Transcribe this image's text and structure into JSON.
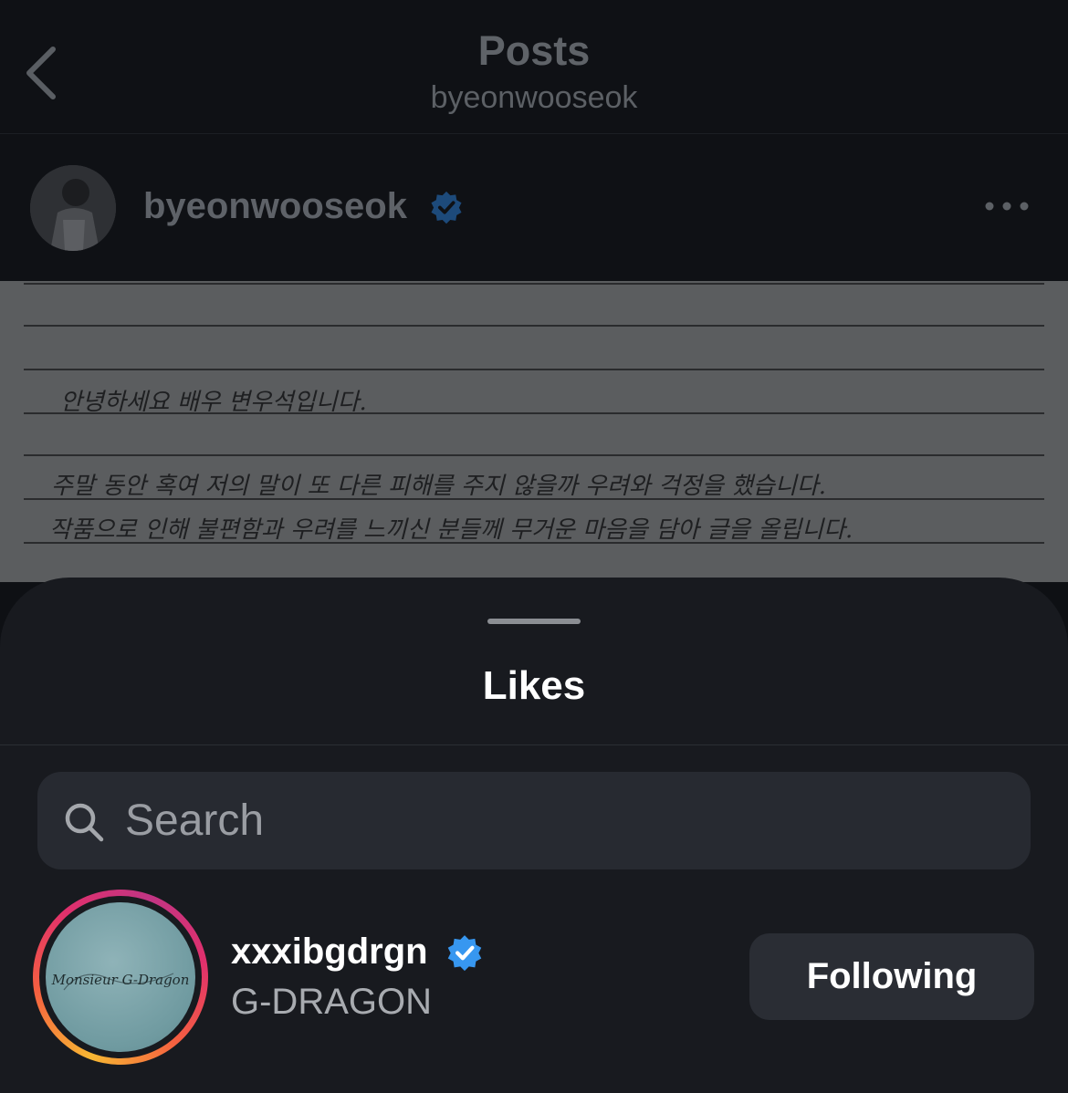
{
  "header": {
    "title": "Posts",
    "subtitle": "byeonwooseok"
  },
  "post": {
    "username": "byeonwooseok",
    "verified": true,
    "letter_lines": [
      "안녕하세요 배우 변우석입니다.",
      "주말 동안 혹여 저의 말이 또 다른 피해를 주지 않을까 우려와 걱정을 했습니다.",
      "작품으로 인해 불편함과 우려를 느끼신 분들께 무거운 마음을 담아 글을 올립니다."
    ]
  },
  "likes_sheet": {
    "title": "Likes",
    "search": {
      "placeholder": "Search",
      "value": ""
    },
    "users": [
      {
        "handle": "xxxibgdrgn",
        "verified": true,
        "name": "G-DRAGON",
        "has_story": true,
        "avatar_text": "Monsieur G-Dragon",
        "button_label": "Following"
      }
    ]
  },
  "colors": {
    "verified_badge": "#3797f0",
    "sheet_bg": "#181a1f",
    "button_bg": "#2a2d34"
  },
  "icons": [
    "back-chevron-icon",
    "verified-badge-icon",
    "more-icon",
    "search-icon"
  ]
}
